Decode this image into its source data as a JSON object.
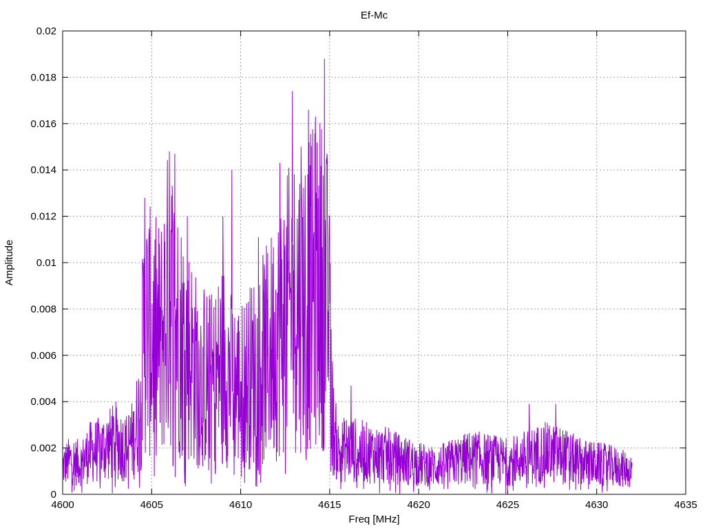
{
  "chart_data": {
    "type": "line",
    "title": "Ef-Mc",
    "xlabel": "Freq [MHz]",
    "ylabel": "Amplitude",
    "xlim": [
      4600,
      4635
    ],
    "ylim": [
      0,
      0.02
    ],
    "x_ticks": [
      "4600",
      "4605",
      "4610",
      "4615",
      "4620",
      "4625",
      "4630",
      "4635"
    ],
    "y_ticks": [
      "0",
      "0.002",
      "0.004",
      "0.006",
      "0.008",
      "0.01",
      "0.012",
      "0.014",
      "0.016",
      "0.018",
      "0.02"
    ],
    "grid": true,
    "series_color": "#9400d3",
    "series": [
      {
        "x_range": [
          4600,
          4632
        ],
        "description_points": [
          [
            4600.0,
            0.0012
          ],
          [
            4600.5,
            0.0015
          ],
          [
            4601.0,
            0.0013
          ],
          [
            4601.5,
            0.0018
          ],
          [
            4602.0,
            0.0019
          ],
          [
            4602.5,
            0.0021
          ],
          [
            4603.0,
            0.0023
          ],
          [
            4603.5,
            0.002
          ],
          [
            4604.0,
            0.0024
          ],
          [
            4604.3,
            0.0035
          ],
          [
            4604.6,
            0.0075
          ],
          [
            4605.0,
            0.007
          ],
          [
            4605.5,
            0.0068
          ],
          [
            4606.0,
            0.009
          ],
          [
            4606.5,
            0.0072
          ],
          [
            4607.0,
            0.0065
          ],
          [
            4607.5,
            0.0055
          ],
          [
            4608.0,
            0.0052
          ],
          [
            4608.5,
            0.005
          ],
          [
            4609.0,
            0.006
          ],
          [
            4609.5,
            0.005
          ],
          [
            4610.0,
            0.0048
          ],
          [
            4610.5,
            0.0052
          ],
          [
            4611.0,
            0.0058
          ],
          [
            4611.5,
            0.0062
          ],
          [
            4612.0,
            0.007
          ],
          [
            4612.5,
            0.0078
          ],
          [
            4613.0,
            0.0085
          ],
          [
            4613.5,
            0.0088
          ],
          [
            4614.0,
            0.009
          ],
          [
            4614.5,
            0.0095
          ],
          [
            4614.9,
            0.0085
          ],
          [
            4615.2,
            0.0028
          ],
          [
            4615.5,
            0.0018
          ],
          [
            4616.0,
            0.002
          ],
          [
            4617.0,
            0.0018
          ],
          [
            4618.0,
            0.0017
          ],
          [
            4619.0,
            0.0015
          ],
          [
            4620.0,
            0.0013
          ],
          [
            4621.0,
            0.0012
          ],
          [
            4622.0,
            0.0014
          ],
          [
            4623.0,
            0.0016
          ],
          [
            4624.0,
            0.0015
          ],
          [
            4625.0,
            0.0014
          ],
          [
            4626.0,
            0.0016
          ],
          [
            4627.0,
            0.0018
          ],
          [
            4628.0,
            0.0017
          ],
          [
            4629.0,
            0.0014
          ],
          [
            4630.0,
            0.0013
          ],
          [
            4631.0,
            0.0012
          ],
          [
            4632.0,
            0.001
          ]
        ],
        "peaks": [
          [
            4604.6,
            0.0128
          ],
          [
            4606.0,
            0.0148
          ],
          [
            4606.3,
            0.0147
          ],
          [
            4607.0,
            0.012
          ],
          [
            4609.0,
            0.012
          ],
          [
            4609.5,
            0.014
          ],
          [
            4611.0,
            0.0111
          ],
          [
            4612.2,
            0.0143
          ],
          [
            4612.9,
            0.0174
          ],
          [
            4613.4,
            0.015
          ],
          [
            4613.8,
            0.0166
          ],
          [
            4614.2,
            0.0163
          ],
          [
            4614.7,
            0.0188
          ],
          [
            4615.0,
            0.012
          ],
          [
            4616.2,
            0.0047
          ],
          [
            4626.2,
            0.0039
          ],
          [
            4627.7,
            0.0039
          ]
        ]
      }
    ]
  }
}
